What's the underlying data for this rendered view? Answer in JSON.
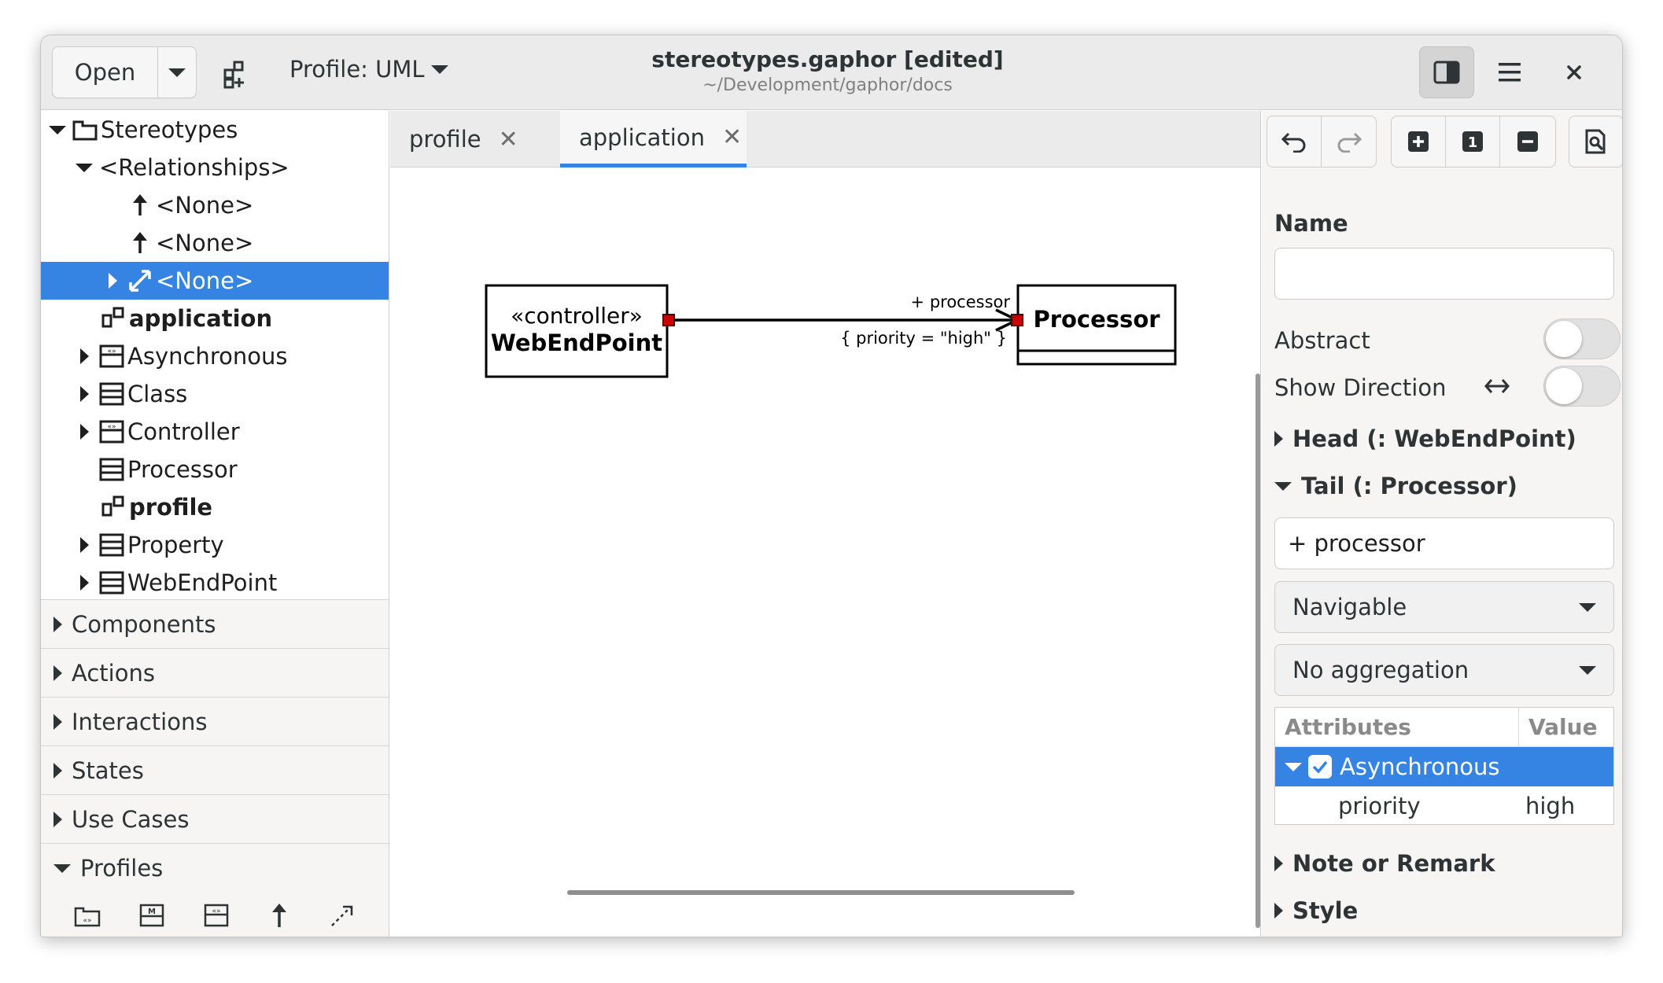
{
  "window": {
    "title": "stereotypes.gaphor [edited]",
    "subtitle": "~/Development/gaphor/docs"
  },
  "header": {
    "open_label": "Open",
    "profile_label": "Profile: UML"
  },
  "tree": {
    "root": "Stereotypes",
    "relationships": "<Relationships>",
    "none_1": "<None>",
    "none_2": "<None>",
    "none_3": "<None>",
    "application": "application",
    "asynchronous": "Asynchronous",
    "class": "Class",
    "controller": "Controller",
    "processor": "Processor",
    "profile": "profile",
    "property": "Property",
    "webendpoint": "WebEndPoint"
  },
  "sections": {
    "components": "Components",
    "actions": "Actions",
    "interactions": "Interactions",
    "states": "States",
    "use_cases": "Use Cases",
    "profiles": "Profiles"
  },
  "tabs": {
    "profile": "profile",
    "application": "application"
  },
  "diagram": {
    "left_stereotype": "«controller»",
    "left_name": "WebEndPoint",
    "right_name": "Processor",
    "end_role": "+ processor",
    "end_constraint": "{ priority = \"high\" }"
  },
  "properties": {
    "name_label": "Name",
    "name_value": "",
    "abstract_label": "Abstract",
    "show_direction_label": "Show Direction",
    "head_label": "Head (: WebEndPoint)",
    "tail_label": "Tail (: Processor)",
    "tail_name_value": "+ processor",
    "navigability": "Navigable",
    "aggregation": "No aggregation",
    "attributes_header": "Attributes",
    "value_header": "Value",
    "stereotype_row": "Asynchronous",
    "attr_name": "priority",
    "attr_value": "high",
    "note_label": "Note or Remark",
    "style_label": "Style"
  },
  "colors": {
    "accent": "#3584e4",
    "handle": "#cc0000"
  }
}
